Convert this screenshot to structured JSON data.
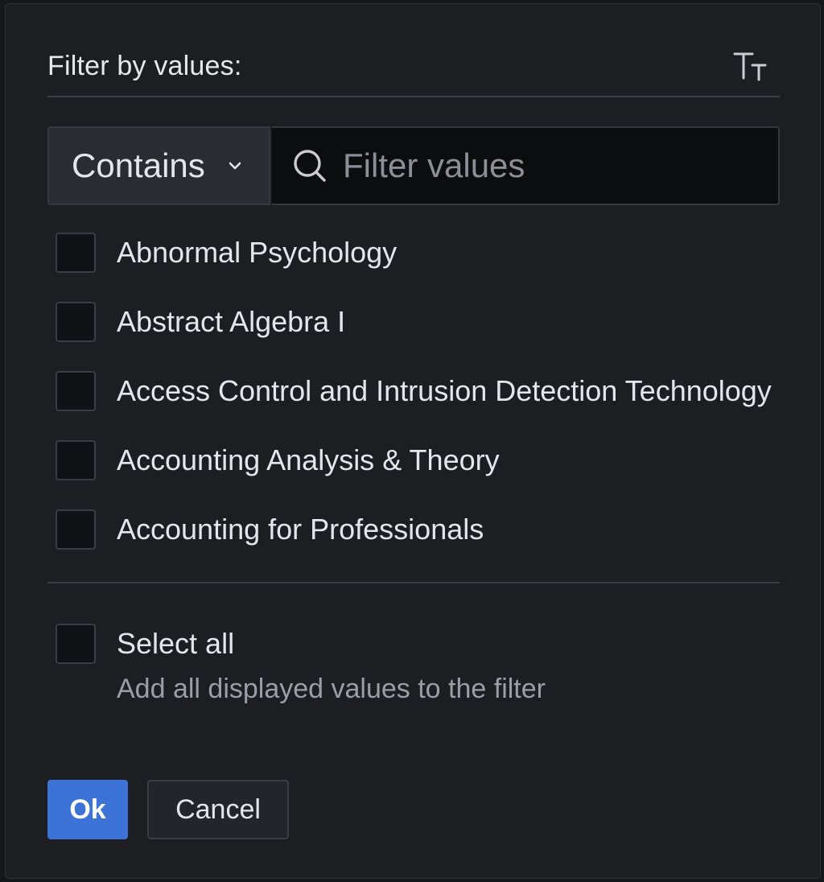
{
  "header": {
    "title": "Filter by values:",
    "text_size_icon": "text-size-icon"
  },
  "filter": {
    "match_mode": "Contains",
    "match_mode_icon": "chevron-down-icon",
    "search_icon": "search-icon",
    "search_placeholder": "Filter values",
    "search_value": ""
  },
  "options": [
    {
      "label": "Abnormal Psychology",
      "checked": false
    },
    {
      "label": "Abstract Algebra I",
      "checked": false
    },
    {
      "label": "Access Control and Intrusion Detection Technology",
      "checked": false
    },
    {
      "label": "Accounting Analysis & Theory",
      "checked": false
    },
    {
      "label": "Accounting for Professionals",
      "checked": false
    }
  ],
  "select_all": {
    "label": "Select all",
    "description": "Add all displayed values to the filter",
    "checked": false
  },
  "actions": {
    "ok_label": "Ok",
    "cancel_label": "Cancel"
  },
  "colors": {
    "panel_bg": "#1c1e22",
    "input_bg": "#0c0d0f",
    "primary": "#3d72d7",
    "text": "#e3e6ea",
    "muted_text": "#9a9ea6"
  }
}
